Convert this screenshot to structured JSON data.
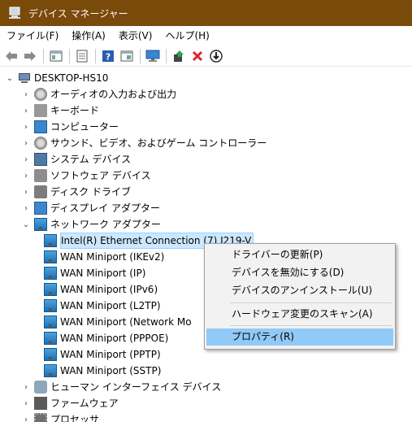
{
  "window": {
    "title": "デバイス マネージャー"
  },
  "menu": [
    "ファイル(F)",
    "操作(A)",
    "表示(V)",
    "ヘルプ(H)"
  ],
  "toolbar": {
    "buttons": [
      "back-arrow-icon",
      "forward-arrow-icon",
      "properties-view-icon",
      "list-view-icon",
      "help-icon",
      "properties-panel-icon",
      "scan-monitor-icon",
      "update-driver-icon",
      "uninstall-x-icon",
      "download-arrow-icon"
    ]
  },
  "tree": {
    "root": "DESKTOP-HS10",
    "categories": [
      "オーディオの入力および出力",
      "キーボード",
      "コンピューター",
      "サウンド、ビデオ、およびゲーム コントローラー",
      "システム デバイス",
      "ソフトウェア デバイス",
      "ディスク ドライブ",
      "ディスプレイ アダプター",
      "ネットワーク アダプター"
    ],
    "network_children": [
      "Intel(R) Ethernet Connection (7) I219-V",
      "WAN Miniport (IKEv2)",
      "WAN Miniport (IP)",
      "WAN Miniport (IPv6)",
      "WAN Miniport (L2TP)",
      "WAN Miniport (Network Mo",
      "WAN Miniport (PPPOE)",
      "WAN Miniport (PPTP)",
      "WAN Miniport (SSTP)"
    ],
    "after_categories": [
      "ヒューマン インターフェイス デバイス",
      "ファームウェア",
      "プロセッサ"
    ]
  },
  "context_menu": {
    "update": "ドライバーの更新(P)",
    "disable": "デバイスを無効にする(D)",
    "uninstall": "デバイスのアンインストール(U)",
    "scan": "ハードウェア変更のスキャン(A)",
    "properties": "プロパティ(R)"
  },
  "colors": {
    "titlebar": "#7a4a0a",
    "selection": "#cce8ff",
    "context_highlight": "#91c9f7"
  }
}
